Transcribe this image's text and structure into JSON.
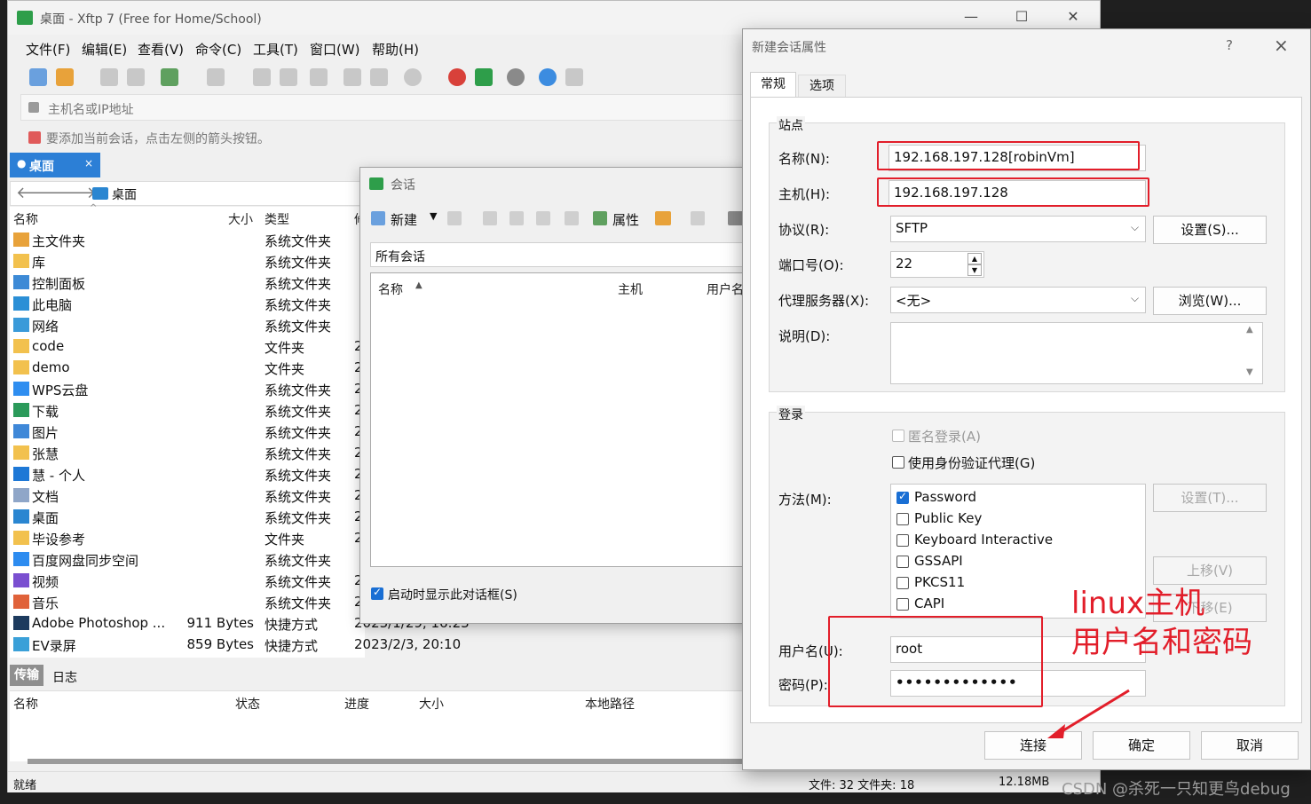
{
  "main_window": {
    "title": "桌面 - Xftp 7 (Free for Home/School)",
    "menu": [
      "文件(F)",
      "编辑(E)",
      "查看(V)",
      "命令(C)",
      "工具(T)",
      "窗口(W)",
      "帮助(H)"
    ],
    "host_placeholder": "主机名或IP地址",
    "hint": "要添加当前会话，点击左侧的箭头按钮。",
    "tab_label": "桌面",
    "tab_close": "×",
    "path_label": "桌面",
    "columns": {
      "name": "名称",
      "size": "大小",
      "type": "类型",
      "modified": "修"
    },
    "files": [
      {
        "name": "主文件夹",
        "size": "",
        "type": "系统文件夹",
        "date": "",
        "icon": "home-icon",
        "color": "#e8a23a"
      },
      {
        "name": "库",
        "size": "",
        "type": "系统文件夹",
        "date": "",
        "icon": "folder-icon",
        "color": "#f2c14e"
      },
      {
        "name": "控制面板",
        "size": "",
        "type": "系统文件夹",
        "date": "",
        "icon": "control-panel-icon",
        "color": "#3d8ad6"
      },
      {
        "name": "此电脑",
        "size": "",
        "type": "系统文件夹",
        "date": "",
        "icon": "computer-icon",
        "color": "#2b8fd6"
      },
      {
        "name": "网络",
        "size": "",
        "type": "系统文件夹",
        "date": "",
        "icon": "network-icon",
        "color": "#3a9ad9"
      },
      {
        "name": "code",
        "size": "",
        "type": "文件夹",
        "date": "2",
        "icon": "folder-icon",
        "color": "#f2c14e"
      },
      {
        "name": "demo",
        "size": "",
        "type": "文件夹",
        "date": "2",
        "icon": "folder-icon",
        "color": "#f2c14e"
      },
      {
        "name": "WPS云盘",
        "size": "",
        "type": "系统文件夹",
        "date": "2",
        "icon": "cloud-icon",
        "color": "#2f8ef0"
      },
      {
        "name": "下载",
        "size": "",
        "type": "系统文件夹",
        "date": "2",
        "icon": "download-icon",
        "color": "#2b9a5a"
      },
      {
        "name": "图片",
        "size": "",
        "type": "系统文件夹",
        "date": "2",
        "icon": "picture-icon",
        "color": "#3f88d8"
      },
      {
        "name": "张慧",
        "size": "",
        "type": "系统文件夹",
        "date": "2",
        "icon": "folder-icon",
        "color": "#f2c14e"
      },
      {
        "name": "慧 - 个人",
        "size": "",
        "type": "系统文件夹",
        "date": "2",
        "icon": "onedrive-icon",
        "color": "#1e78d6"
      },
      {
        "name": "文档",
        "size": "",
        "type": "系统文件夹",
        "date": "2",
        "icon": "document-icon",
        "color": "#8fa6c8"
      },
      {
        "name": "桌面",
        "size": "",
        "type": "系统文件夹",
        "date": "2",
        "icon": "desktop-icon",
        "color": "#2a86d1"
      },
      {
        "name": "毕设参考",
        "size": "",
        "type": "文件夹",
        "date": "2",
        "icon": "folder-icon",
        "color": "#f2c14e"
      },
      {
        "name": "百度网盘同步空间",
        "size": "",
        "type": "系统文件夹",
        "date": "",
        "icon": "baidu-cloud-icon",
        "color": "#2d8cf0"
      },
      {
        "name": "视频",
        "size": "",
        "type": "系统文件夹",
        "date": "2",
        "icon": "video-icon",
        "color": "#7a4fd0"
      },
      {
        "name": "音乐",
        "size": "",
        "type": "系统文件夹",
        "date": "2",
        "icon": "music-icon",
        "color": "#e0623a"
      },
      {
        "name": "Adobe Photoshop ...",
        "size": "911 Bytes",
        "type": "快捷方式",
        "date": "2023/1/29, 16:23",
        "icon": "photoshop-icon",
        "color": "#1d3b5e"
      },
      {
        "name": "EV录屏",
        "size": "859 Bytes",
        "type": "快捷方式",
        "date": "2023/2/3, 20:10",
        "icon": "ev-recorder-icon",
        "color": "#3aa0d8"
      }
    ],
    "bottom_tabs": [
      "传输",
      "日志"
    ],
    "transfer_columns": [
      "名称",
      "状态",
      "进度",
      "大小",
      "本地路径"
    ],
    "status": {
      "left": "就绪",
      "files": "文件: 32  文件夹: 18",
      "size": "12.18MB"
    }
  },
  "session_dialog": {
    "title": "会话",
    "new_label": "新建",
    "properties_label": "属性",
    "folder_label": "所有会话",
    "columns": {
      "name": "名称",
      "host": "主机",
      "user": "用户名"
    },
    "show_on_startup": "启动时显示此对话框(S)"
  },
  "props_dialog": {
    "title": "新建会话属性",
    "help": "?",
    "close": "×",
    "tabs": [
      "常规",
      "选项"
    ],
    "site_group": "站点",
    "name_label": "名称(N):",
    "name_value": "192.168.197.128[robinVm]",
    "host_label": "主机(H):",
    "host_value": "192.168.197.128",
    "protocol_label": "协议(R):",
    "protocol_value": "SFTP",
    "settings_button": "设置(S)...",
    "port_label": "端口号(O):",
    "port_value": "22",
    "proxy_label": "代理服务器(X):",
    "proxy_value": "<无>",
    "browse_button": "浏览(W)...",
    "desc_label": "说明(D):",
    "login_group": "登录",
    "anon_label": "匿名登录(A)",
    "agent_label": "使用身份验证代理(G)",
    "method_label": "方法(M):",
    "methods": [
      {
        "label": "Password",
        "checked": true
      },
      {
        "label": "Public Key",
        "checked": false
      },
      {
        "label": "Keyboard Interactive",
        "checked": false
      },
      {
        "label": "GSSAPI",
        "checked": false
      },
      {
        "label": "PKCS11",
        "checked": false
      },
      {
        "label": "CAPI",
        "checked": false
      }
    ],
    "method_settings": "设置(T)...",
    "move_up": "上移(V)",
    "move_down": "下移(E)",
    "user_label": "用户名(U):",
    "user_value": "root",
    "pass_label": "密码(P):",
    "pass_value": "•••••••••••••",
    "connect": "连接",
    "ok": "确定",
    "cancel": "取消"
  },
  "annotation": {
    "line1": "linux主机",
    "line2": "用户名和密码",
    "color": "#e21e2a"
  },
  "watermark": "CSDN @杀死一只知更鸟debug"
}
